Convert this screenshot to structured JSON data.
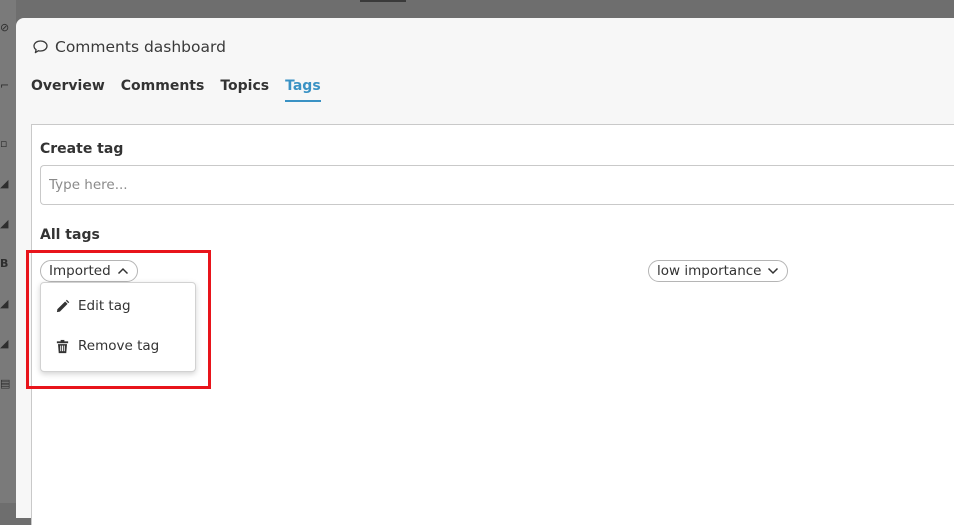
{
  "modal": {
    "title": "Comments dashboard",
    "tabs": [
      {
        "label": "Overview",
        "active": false
      },
      {
        "label": "Comments",
        "active": false
      },
      {
        "label": "Topics",
        "active": false
      },
      {
        "label": "Tags",
        "active": true
      }
    ]
  },
  "create_tag": {
    "label": "Create tag",
    "placeholder": "Type here..."
  },
  "all_tags": {
    "label": "All tags",
    "tags": [
      {
        "label": "Imported",
        "expanded": true
      },
      {
        "label": "low importance",
        "expanded": false
      }
    ]
  },
  "tag_menu": {
    "items": [
      {
        "label": "Edit tag",
        "icon": "pencil-icon"
      },
      {
        "label": "Remove tag",
        "icon": "trash-icon"
      }
    ]
  },
  "colors": {
    "accent": "#3a92c4",
    "highlight": "#e8141b"
  }
}
